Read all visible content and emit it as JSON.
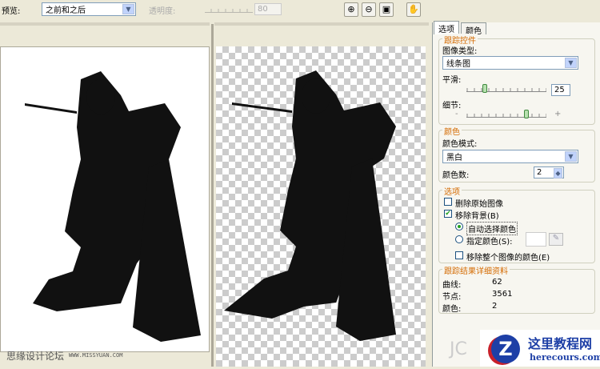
{
  "toolbar": {
    "preview_label": "预览:",
    "preview_value": "之前和之后",
    "opacity_label": "透明度:",
    "opacity_value": "80"
  },
  "tabs": [
    {
      "label": "选项"
    },
    {
      "label": "颜色"
    }
  ],
  "trace_controls": {
    "title": "跟踪控件",
    "image_type_label": "图像类型:",
    "image_type_value": "线条图",
    "smooth_label": "平滑:",
    "smooth_value": "25",
    "detail_label": "细节:",
    "detail_minus": "-",
    "detail_plus": "+",
    "detail_level": 0.75
  },
  "color": {
    "title": "颜色",
    "mode_label": "颜色模式:",
    "mode_value": "黑白",
    "count_label": "颜色数:",
    "count_value": "2"
  },
  "options": {
    "title": "选项",
    "delete_original": "删除原始图像",
    "delete_original_checked": false,
    "remove_bg": "移除背景(B)",
    "remove_bg_checked": true,
    "auto_color": "自动选择颜色",
    "specify_color": "指定颜色(S):",
    "remove_whole": "移除整个图像的颜色(E)"
  },
  "details": {
    "title": "跟踪结果详细资料",
    "curves_label": "曲线:",
    "curves_value": "62",
    "nodes_label": "节点:",
    "nodes_value": "3561",
    "colors_label": "颜色:",
    "colors_value": "2"
  },
  "watermarks": {
    "left_cn": "思缘设计论坛",
    "left_url": "WWW.MISSYUAN.COM",
    "jc": "JC",
    "logo_cn": "这里教程网",
    "logo_url": "herecours.com"
  }
}
